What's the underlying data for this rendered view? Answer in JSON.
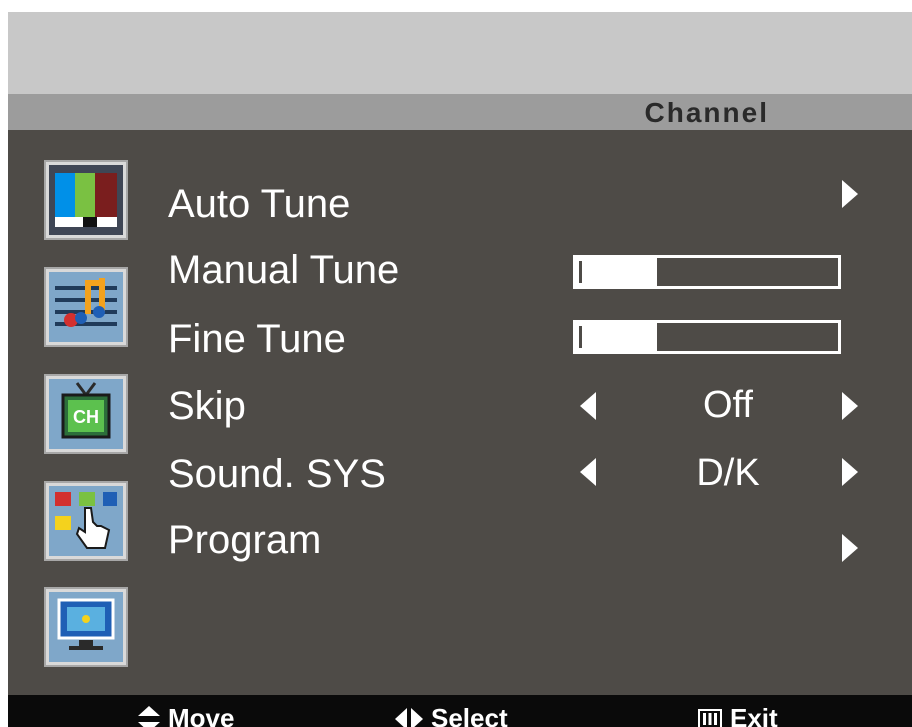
{
  "header": {
    "title": "Channel"
  },
  "sidebar": {
    "icons": [
      {
        "name": "picture-icon"
      },
      {
        "name": "sound-icon"
      },
      {
        "name": "channel-icon"
      },
      {
        "name": "function-icon"
      },
      {
        "name": "screen-icon"
      }
    ],
    "channel_icon_text": "CH"
  },
  "menu": {
    "auto_tune": {
      "label": "Auto Tune"
    },
    "manual_tune": {
      "label": "Manual Tune",
      "level": 0.31
    },
    "fine_tune": {
      "label": "Fine Tune",
      "level": 0.31
    },
    "skip": {
      "label": "Skip",
      "value": "Off"
    },
    "sound_sys": {
      "label": "Sound. SYS",
      "value": "D/K"
    },
    "program": {
      "label": "Program"
    }
  },
  "footer": {
    "move_label": "Move",
    "select_label": "Select",
    "exit_label": "Exit"
  },
  "colors": {
    "panel": "#4e4b47",
    "header_band": "#c8c8c8",
    "title_bar": "#9c9c9c",
    "footer": "#0a0a0a",
    "text": "#ffffff"
  }
}
